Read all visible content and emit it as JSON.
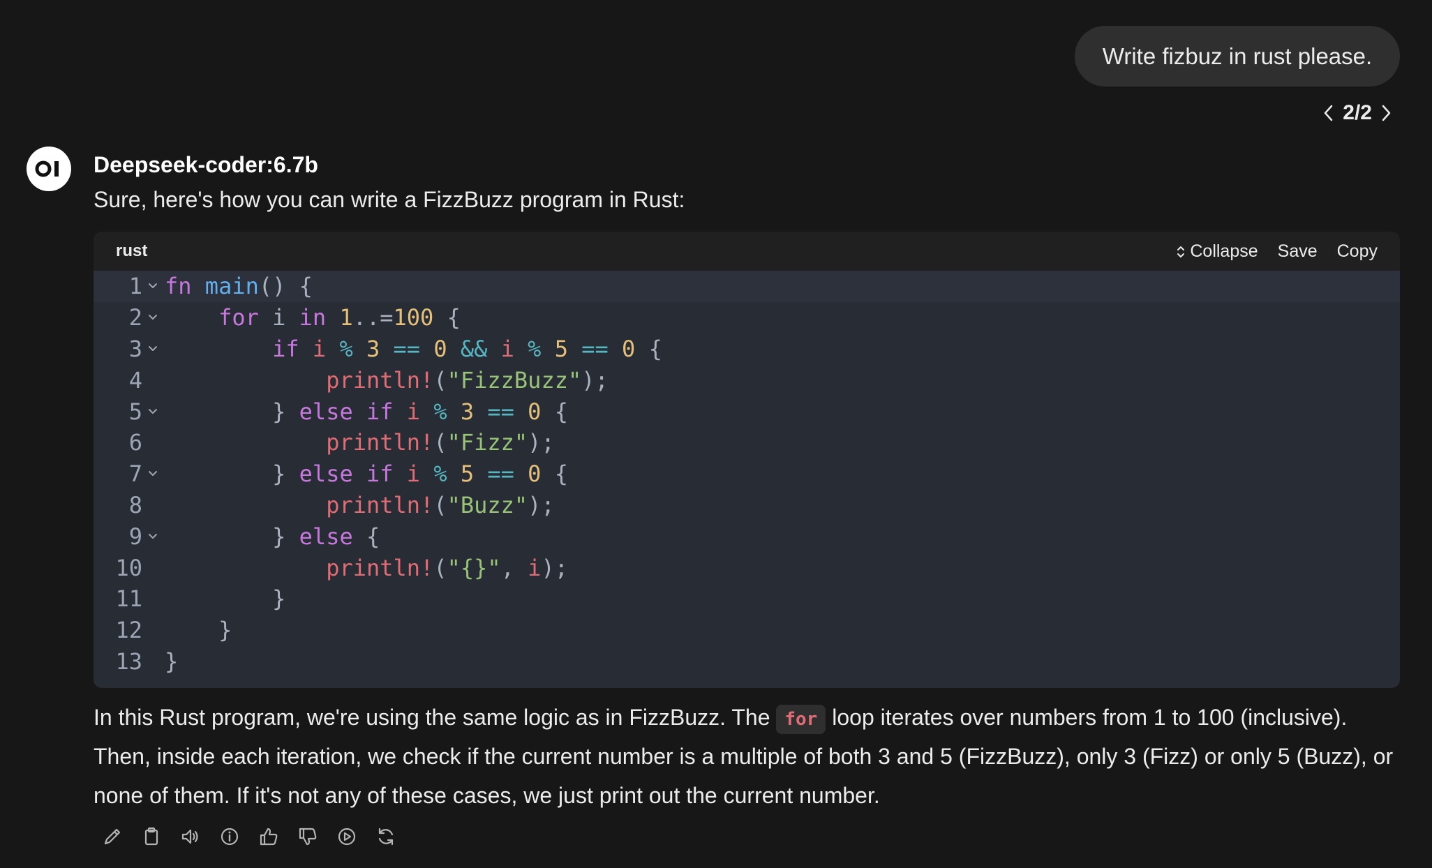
{
  "user_message": {
    "text": "Write fizbuz in rust please.",
    "pager": "2/2"
  },
  "assistant": {
    "avatar_text": "OI",
    "model_name": "Deepseek-coder:6.7b",
    "intro": "Sure, here's how you can write a FizzBuzz program in Rust:",
    "code_block": {
      "language": "rust",
      "actions": {
        "collapse": "Collapse",
        "save": "Save",
        "copy": "Copy"
      },
      "lines": [
        {
          "n": "1",
          "fold": true,
          "tokens": [
            [
              "kw",
              "fn "
            ],
            [
              "fn",
              "main"
            ],
            [
              "punc",
              "() {"
            ]
          ]
        },
        {
          "n": "2",
          "fold": true,
          "tokens": [
            [
              "punc",
              "    "
            ],
            [
              "kw",
              "for"
            ],
            [
              "punc",
              " i "
            ],
            [
              "kw",
              "in"
            ],
            [
              "punc",
              " "
            ],
            [
              "num-l",
              "1"
            ],
            [
              "punc",
              "..="
            ],
            [
              "num-l",
              "100"
            ],
            [
              "punc",
              " {"
            ]
          ]
        },
        {
          "n": "3",
          "fold": true,
          "tokens": [
            [
              "punc",
              "        "
            ],
            [
              "kw",
              "if"
            ],
            [
              "punc",
              " "
            ],
            [
              "var",
              "i"
            ],
            [
              "punc",
              " "
            ],
            [
              "op",
              "%"
            ],
            [
              "punc",
              " "
            ],
            [
              "num-l",
              "3"
            ],
            [
              "punc",
              " "
            ],
            [
              "op",
              "=="
            ],
            [
              "punc",
              " "
            ],
            [
              "num-l",
              "0"
            ],
            [
              "punc",
              " "
            ],
            [
              "op",
              "&&"
            ],
            [
              "punc",
              " "
            ],
            [
              "var",
              "i"
            ],
            [
              "punc",
              " "
            ],
            [
              "op",
              "%"
            ],
            [
              "punc",
              " "
            ],
            [
              "num-l",
              "5"
            ],
            [
              "punc",
              " "
            ],
            [
              "op",
              "=="
            ],
            [
              "punc",
              " "
            ],
            [
              "num-l",
              "0"
            ],
            [
              "punc",
              " {"
            ]
          ]
        },
        {
          "n": "4",
          "fold": false,
          "tokens": [
            [
              "punc",
              "            "
            ],
            [
              "mac",
              "println!"
            ],
            [
              "punc",
              "("
            ],
            [
              "str",
              "\"FizzBuzz\""
            ],
            [
              "punc",
              ");"
            ]
          ]
        },
        {
          "n": "5",
          "fold": true,
          "tokens": [
            [
              "punc",
              "        } "
            ],
            [
              "kw",
              "else if"
            ],
            [
              "punc",
              " "
            ],
            [
              "var",
              "i"
            ],
            [
              "punc",
              " "
            ],
            [
              "op",
              "%"
            ],
            [
              "punc",
              " "
            ],
            [
              "num-l",
              "3"
            ],
            [
              "punc",
              " "
            ],
            [
              "op",
              "=="
            ],
            [
              "punc",
              " "
            ],
            [
              "num-l",
              "0"
            ],
            [
              "punc",
              " {"
            ]
          ]
        },
        {
          "n": "6",
          "fold": false,
          "tokens": [
            [
              "punc",
              "            "
            ],
            [
              "mac",
              "println!"
            ],
            [
              "punc",
              "("
            ],
            [
              "str",
              "\"Fizz\""
            ],
            [
              "punc",
              ");"
            ]
          ]
        },
        {
          "n": "7",
          "fold": true,
          "tokens": [
            [
              "punc",
              "        } "
            ],
            [
              "kw",
              "else if"
            ],
            [
              "punc",
              " "
            ],
            [
              "var",
              "i"
            ],
            [
              "punc",
              " "
            ],
            [
              "op",
              "%"
            ],
            [
              "punc",
              " "
            ],
            [
              "num-l",
              "5"
            ],
            [
              "punc",
              " "
            ],
            [
              "op",
              "=="
            ],
            [
              "punc",
              " "
            ],
            [
              "num-l",
              "0"
            ],
            [
              "punc",
              " {"
            ]
          ]
        },
        {
          "n": "8",
          "fold": false,
          "tokens": [
            [
              "punc",
              "            "
            ],
            [
              "mac",
              "println!"
            ],
            [
              "punc",
              "("
            ],
            [
              "str",
              "\"Buzz\""
            ],
            [
              "punc",
              ");"
            ]
          ]
        },
        {
          "n": "9",
          "fold": true,
          "tokens": [
            [
              "punc",
              "        } "
            ],
            [
              "kw",
              "else"
            ],
            [
              "punc",
              " {"
            ]
          ]
        },
        {
          "n": "10",
          "fold": false,
          "tokens": [
            [
              "punc",
              "            "
            ],
            [
              "mac",
              "println!"
            ],
            [
              "punc",
              "("
            ],
            [
              "str",
              "\"{}\""
            ],
            [
              "punc",
              ", "
            ],
            [
              "var",
              "i"
            ],
            [
              "punc",
              ");"
            ]
          ]
        },
        {
          "n": "11",
          "fold": false,
          "tokens": [
            [
              "punc",
              "        }"
            ]
          ]
        },
        {
          "n": "12",
          "fold": false,
          "tokens": [
            [
              "punc",
              "    }"
            ]
          ]
        },
        {
          "n": "13",
          "fold": false,
          "tokens": [
            [
              "punc",
              "}"
            ]
          ]
        }
      ]
    },
    "explanation": {
      "before": "In this Rust program, we're using the same logic as in FizzBuzz. The ",
      "inline_code": "for",
      "after": " loop iterates over numbers from 1 to 100 (inclusive). Then, inside each iteration, we check if the current number is a multiple of both 3 and 5 (FizzBuzz), only 3 (Fizz) or only 5 (Buzz), or none of them. If it's not any of these cases, we just print out the current number."
    },
    "toolbar_icons": [
      "edit-icon",
      "copy-clipboard-icon",
      "read-aloud-icon",
      "info-icon",
      "thumbs-up-icon",
      "thumbs-down-icon",
      "continue-play-icon",
      "regenerate-icon"
    ]
  }
}
